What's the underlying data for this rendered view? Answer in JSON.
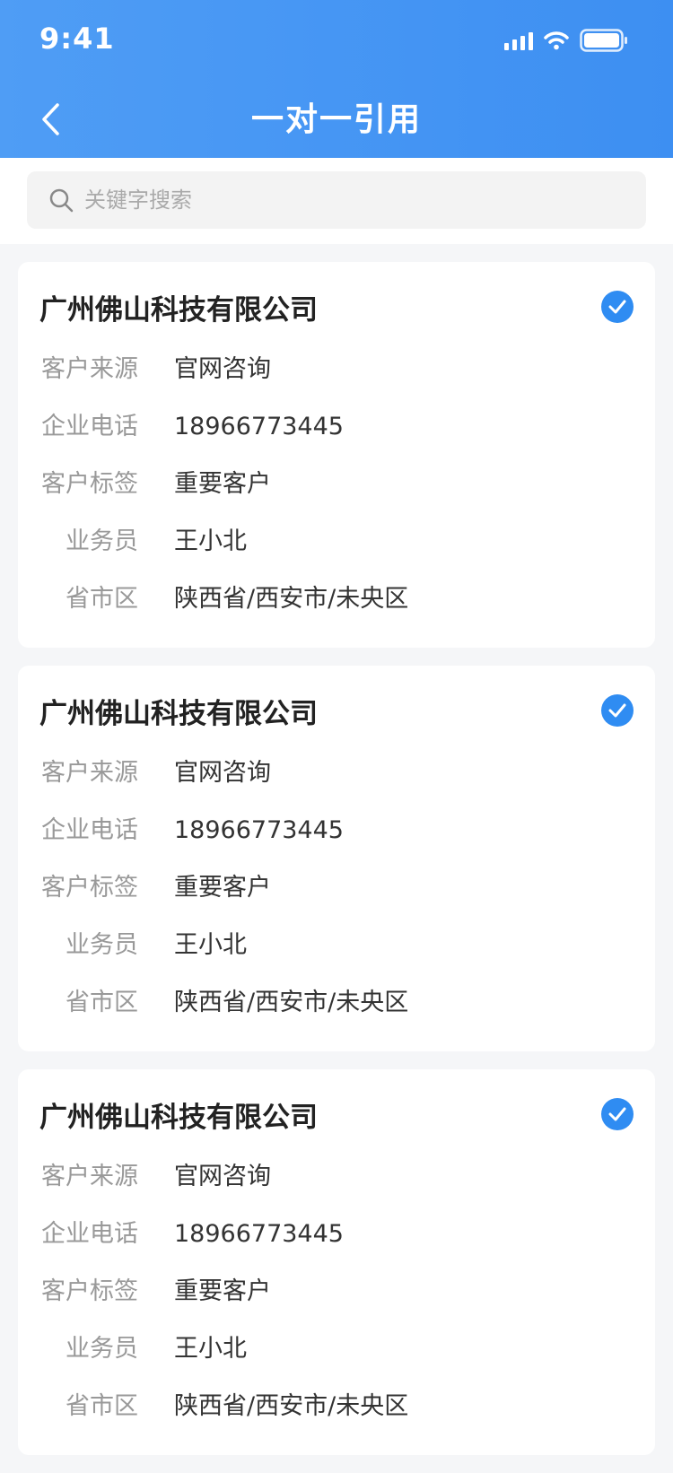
{
  "status": {
    "time": "9:41"
  },
  "header": {
    "title": "一对一引用"
  },
  "search": {
    "placeholder": "关键字搜索"
  },
  "labels": {
    "source": "客户来源",
    "phone": "企业电话",
    "tag": "客户标签",
    "salesperson": "业务员",
    "region": "省市区"
  },
  "cards": [
    {
      "company": "广州佛山科技有限公司",
      "source": "官网咨询",
      "phone": "18966773445",
      "tag": "重要客户",
      "salesperson": "王小北",
      "region": "陕西省/西安市/未央区",
      "checked": true
    },
    {
      "company": "广州佛山科技有限公司",
      "source": "官网咨询",
      "phone": "18966773445",
      "tag": "重要客户",
      "salesperson": "王小北",
      "region": "陕西省/西安市/未央区",
      "checked": true
    },
    {
      "company": "广州佛山科技有限公司",
      "source": "官网咨询",
      "phone": "18966773445",
      "tag": "重要客户",
      "salesperson": "王小北",
      "region": "陕西省/西安市/未央区",
      "checked": true
    }
  ],
  "colors": {
    "header": "#3d8ff2",
    "check": "#2f8cf2"
  }
}
